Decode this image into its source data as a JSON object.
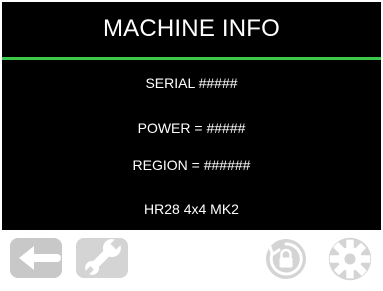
{
  "header": {
    "title": "MACHINE INFO"
  },
  "info": {
    "serial": "SERIAL #####",
    "power": "POWER = #####",
    "region": "REGION = ######",
    "model": "HR28 4x4 MK2"
  },
  "footer": {
    "buttons": [
      {
        "icon": "back-arrow-icon"
      },
      {
        "icon": "wrench-icon"
      },
      {
        "icon": "lock-rotate-icon"
      },
      {
        "icon": "gear-icon"
      }
    ]
  },
  "colors": {
    "screen_bg": "#000000",
    "accent_line": "#3cc84a",
    "text": "#ffffff",
    "button_gray": "#c8c8c8"
  }
}
